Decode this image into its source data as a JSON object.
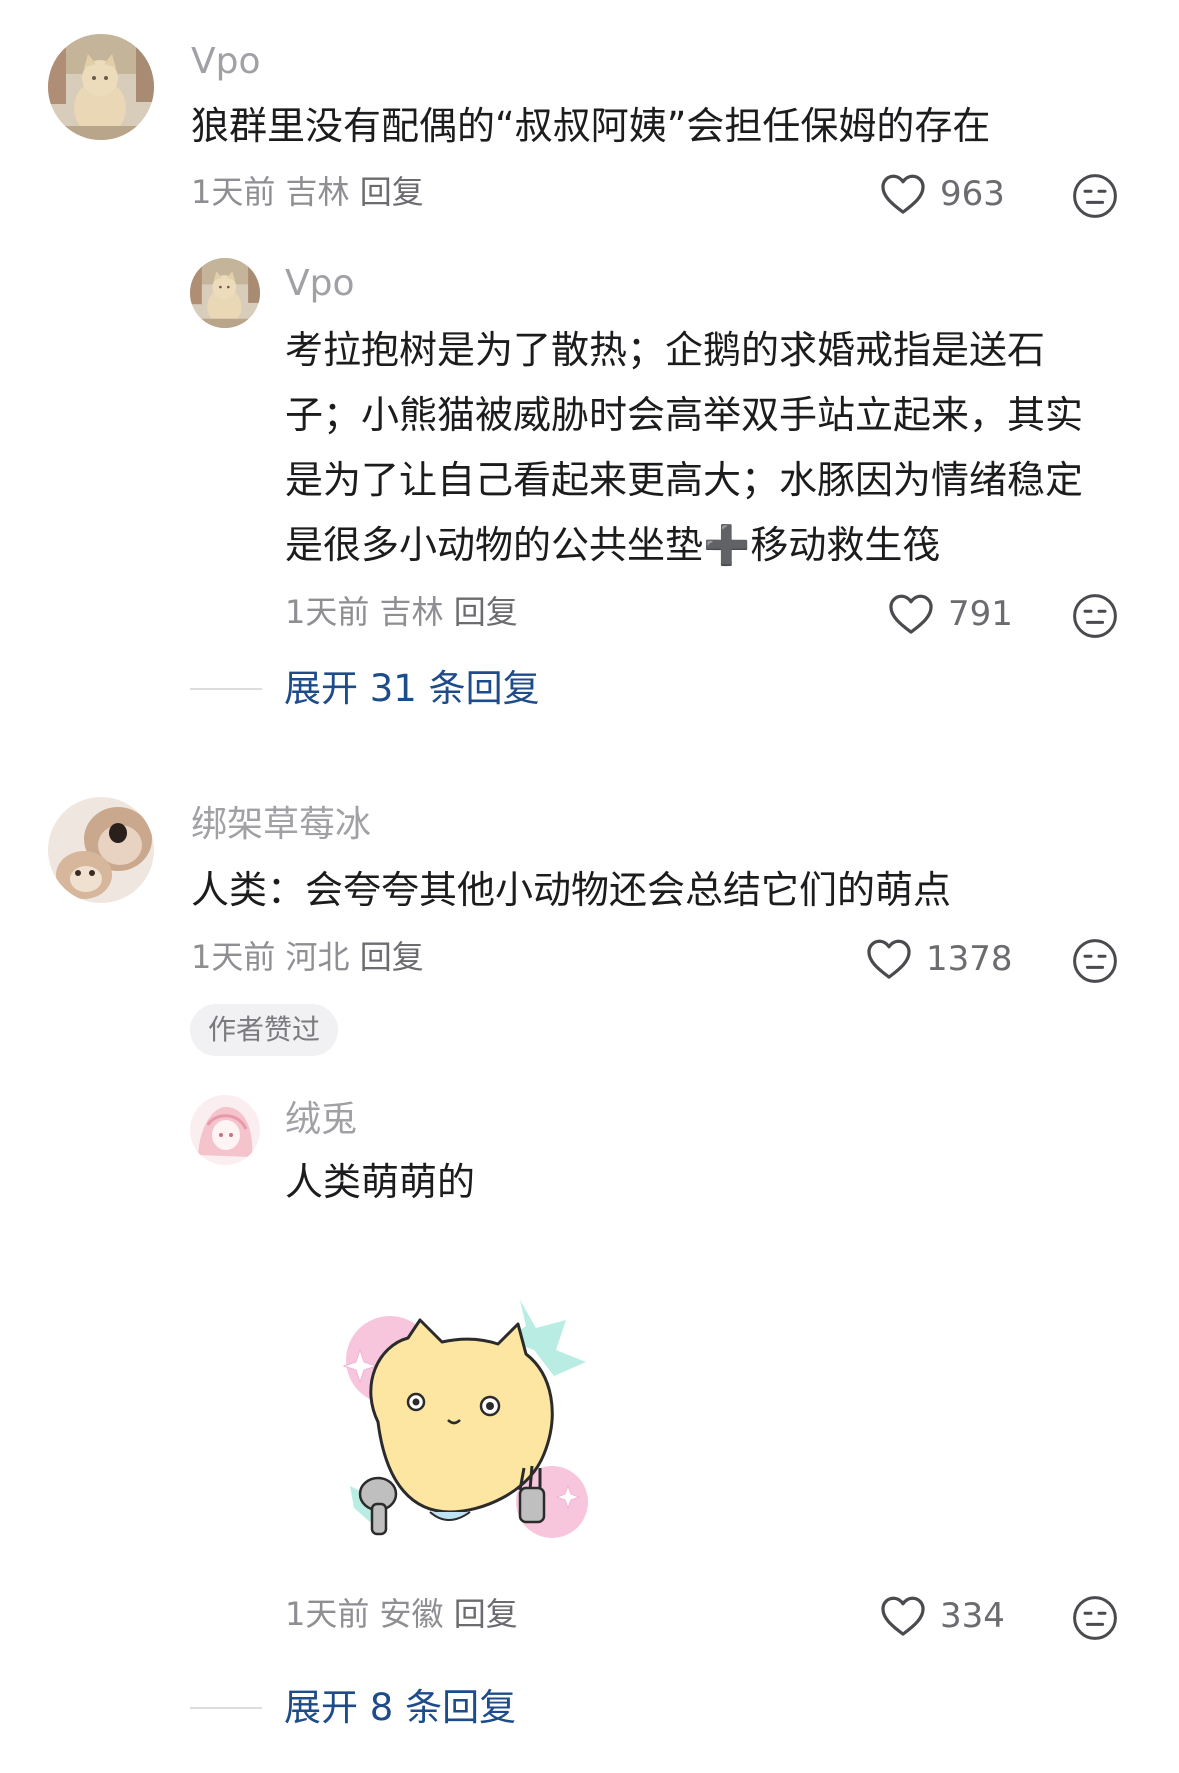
{
  "comments": [
    {
      "author": "Vpo",
      "text": "狼群里没有配偶的“叔叔阿姨”会担任保姆的存在",
      "time": "1天前",
      "location": "吉林",
      "reply_label": "回复",
      "likes": "963",
      "replies": [
        {
          "author": "Vpo",
          "text": "考拉抱树是为了散热；企鹅的求婚戒指是送石子；小熊猫被威胁时会高举双手站立起来，其实是为了让自己看起来更高大；水豚因为情绪稳定是很多小动物的公共坐垫➕移动救生筏",
          "time": "1天前",
          "location": "吉林",
          "reply_label": "回复",
          "likes": "791"
        }
      ],
      "expand_label": "展开 31 条回复"
    },
    {
      "author": "绑架草莓冰",
      "text": "人类：会夸夸其他小动物还会总结它们的萌点",
      "time": "1天前",
      "location": "河北",
      "reply_label": "回复",
      "likes": "1378",
      "badge": "作者赞过",
      "replies": [
        {
          "author": "绒兎",
          "text": "人类萌萌的",
          "sticker": "cat-sticker",
          "time": "1天前",
          "location": "安徽",
          "reply_label": "回复",
          "likes": "334"
        }
      ],
      "expand_label": "展开 8 条回复"
    }
  ],
  "icons": {
    "like": "heart-outline-icon",
    "dislike": "meh-face-icon"
  },
  "colors": {
    "link": "#1e4c8a",
    "muted": "#8e8e93",
    "name": "#a0a0a5"
  }
}
